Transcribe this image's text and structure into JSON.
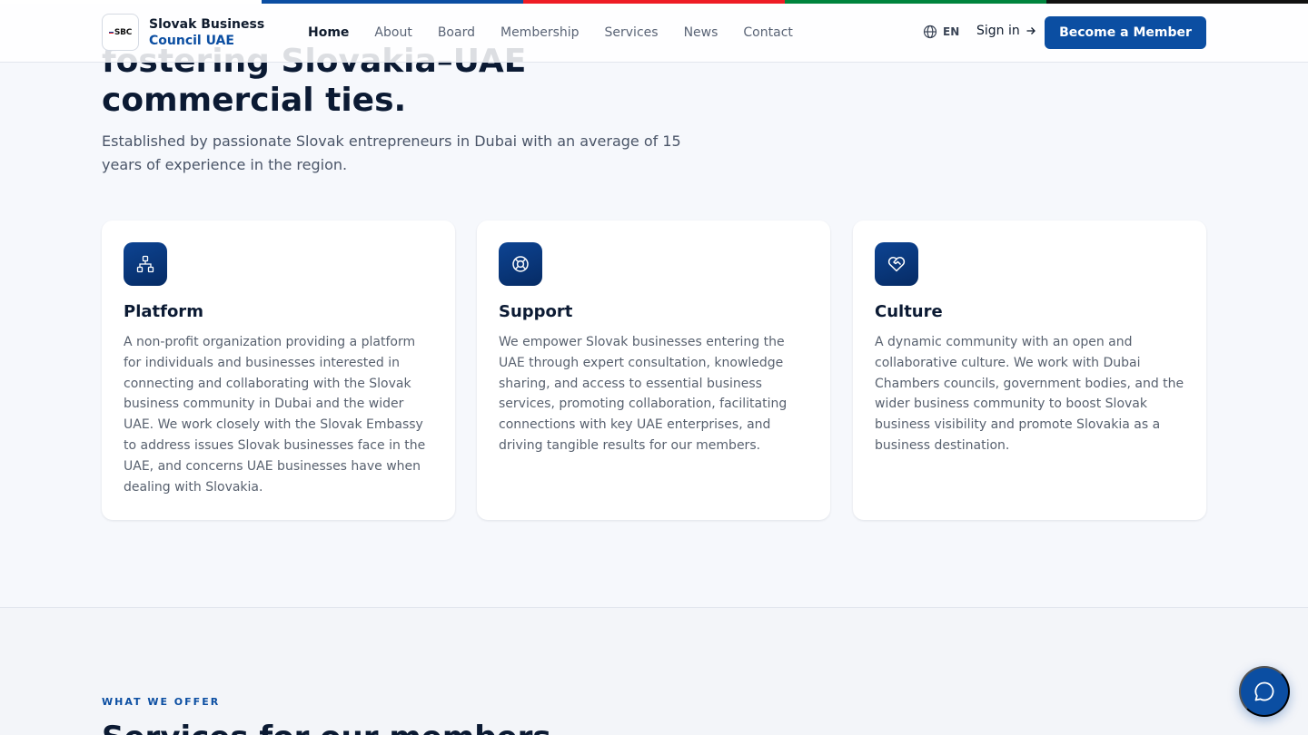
{
  "colors": {
    "brand_blue": "#0b4ea2",
    "flag": [
      "#ffffff",
      "#0b4ea2",
      "#ee1c25",
      "#00843d",
      "#111111"
    ]
  },
  "header": {
    "logo_mark": "SBC",
    "brand_line1": "Slovak Business",
    "brand_line2": "Council UAE",
    "nav": [
      {
        "label": "Home",
        "active": true
      },
      {
        "label": "About"
      },
      {
        "label": "Board"
      },
      {
        "label": "Membership"
      },
      {
        "label": "Services"
      },
      {
        "label": "News"
      },
      {
        "label": "Contact"
      }
    ],
    "lang": {
      "icon": "globe-icon",
      "label": "EN"
    },
    "signin": {
      "label": "Sign in",
      "icon": "arrow-right-icon"
    },
    "cta": "Become a Member"
  },
  "hero": {
    "title_line1": "fostering Slovakia–UAE",
    "title_line2": "commercial ties.",
    "subtitle": "Established by passionate Slovak entrepreneurs in Dubai with an average of 15 years of experience in the region."
  },
  "cards": [
    {
      "icon": "network-icon",
      "title": "Platform",
      "text": "A non-profit organization providing a platform for individuals and businesses interested in connecting and collaborating with the Slovak business community in Dubai and the wider UAE. We work closely with the Slovak Embassy to address issues Slovak businesses face in the UAE, and concerns UAE businesses have when dealing with Slovakia."
    },
    {
      "icon": "lifebuoy-icon",
      "title": "Support",
      "text": "We empower Slovak businesses entering the UAE through expert consultation, knowledge sharing, and access to essential business services, promoting collaboration, facilitating connections with key UAE enterprises, and driving tangible results for our members."
    },
    {
      "icon": "heart-handshake-icon",
      "title": "Culture",
      "text": "A dynamic community with an open and collaborative culture. We work with Dubai Chambers councils, government bodies, and the wider business community to boost Slovak business visibility and promote Slovakia as a business destination."
    }
  ],
  "offer": {
    "eyebrow": "WHAT WE OFFER",
    "title": "Services for our members"
  },
  "chat": {
    "icon": "chat-bubble-icon"
  }
}
